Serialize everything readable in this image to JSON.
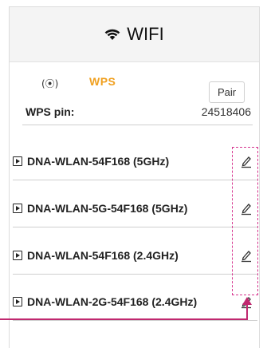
{
  "header": {
    "title": "WIFI",
    "icon": "wifi-icon"
  },
  "wps": {
    "icon_glyph": "(⦿)",
    "label": "WPS",
    "pair_button": "Pair",
    "label_color": "#f0a020"
  },
  "pin": {
    "label": "WPS pin:",
    "value": "24518406"
  },
  "networks": [
    {
      "name": "DNA-WLAN-54F168 (5GHz)"
    },
    {
      "name": "DNA-WLAN-5G-54F168 (5GHz)"
    },
    {
      "name": "DNA-WLAN-54F168 (2.4GHz)"
    },
    {
      "name": "DNA-WLAN-2G-54F168 (2.4GHz)"
    }
  ],
  "annotation": {
    "color": "#d6338e"
  }
}
